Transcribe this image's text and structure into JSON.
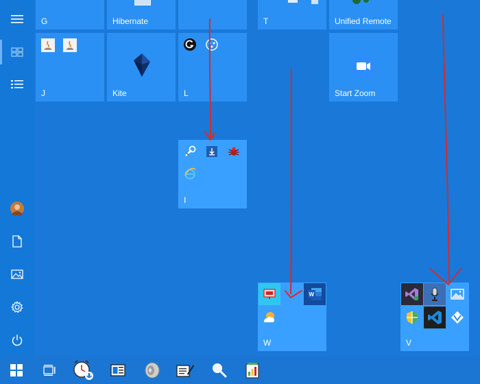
{
  "start_menu": {
    "rail": {
      "items": [
        {
          "name": "menu-icon"
        },
        {
          "name": "all-tiles-icon"
        },
        {
          "name": "all-apps-list-icon"
        },
        {
          "name": "user-avatar-icon"
        },
        {
          "name": "documents-icon"
        },
        {
          "name": "pictures-icon"
        },
        {
          "name": "settings-gear-icon"
        },
        {
          "name": "power-icon"
        }
      ]
    },
    "tiles": {
      "g": {
        "label": "G"
      },
      "hibernate": {
        "label": "Hibernate"
      },
      "t": {
        "label": "T"
      },
      "unified_remote": {
        "label": "Unified Remote"
      },
      "j": {
        "label": "J"
      },
      "kite": {
        "label": "Kite"
      },
      "l": {
        "label": "L"
      },
      "start_zoom": {
        "label": "Start Zoom"
      },
      "i": {
        "label": "I"
      },
      "w": {
        "label": "W"
      },
      "v": {
        "label": "V"
      }
    },
    "taskbar": {
      "items": [
        {
          "name": "windows-start-icon"
        },
        {
          "name": "task-view-icon"
        },
        {
          "name": "alarm-clock-app-icon"
        },
        {
          "name": "news-app-icon"
        },
        {
          "name": "speaker-app-icon"
        },
        {
          "name": "notes-app-icon"
        },
        {
          "name": "search-magnifier-app-icon"
        },
        {
          "name": "notepad-chart-app-icon"
        }
      ]
    }
  },
  "colors": {
    "background": "#1a78d8",
    "tile": "#2a90f4",
    "annotation_arrow": "#d62b2b"
  }
}
